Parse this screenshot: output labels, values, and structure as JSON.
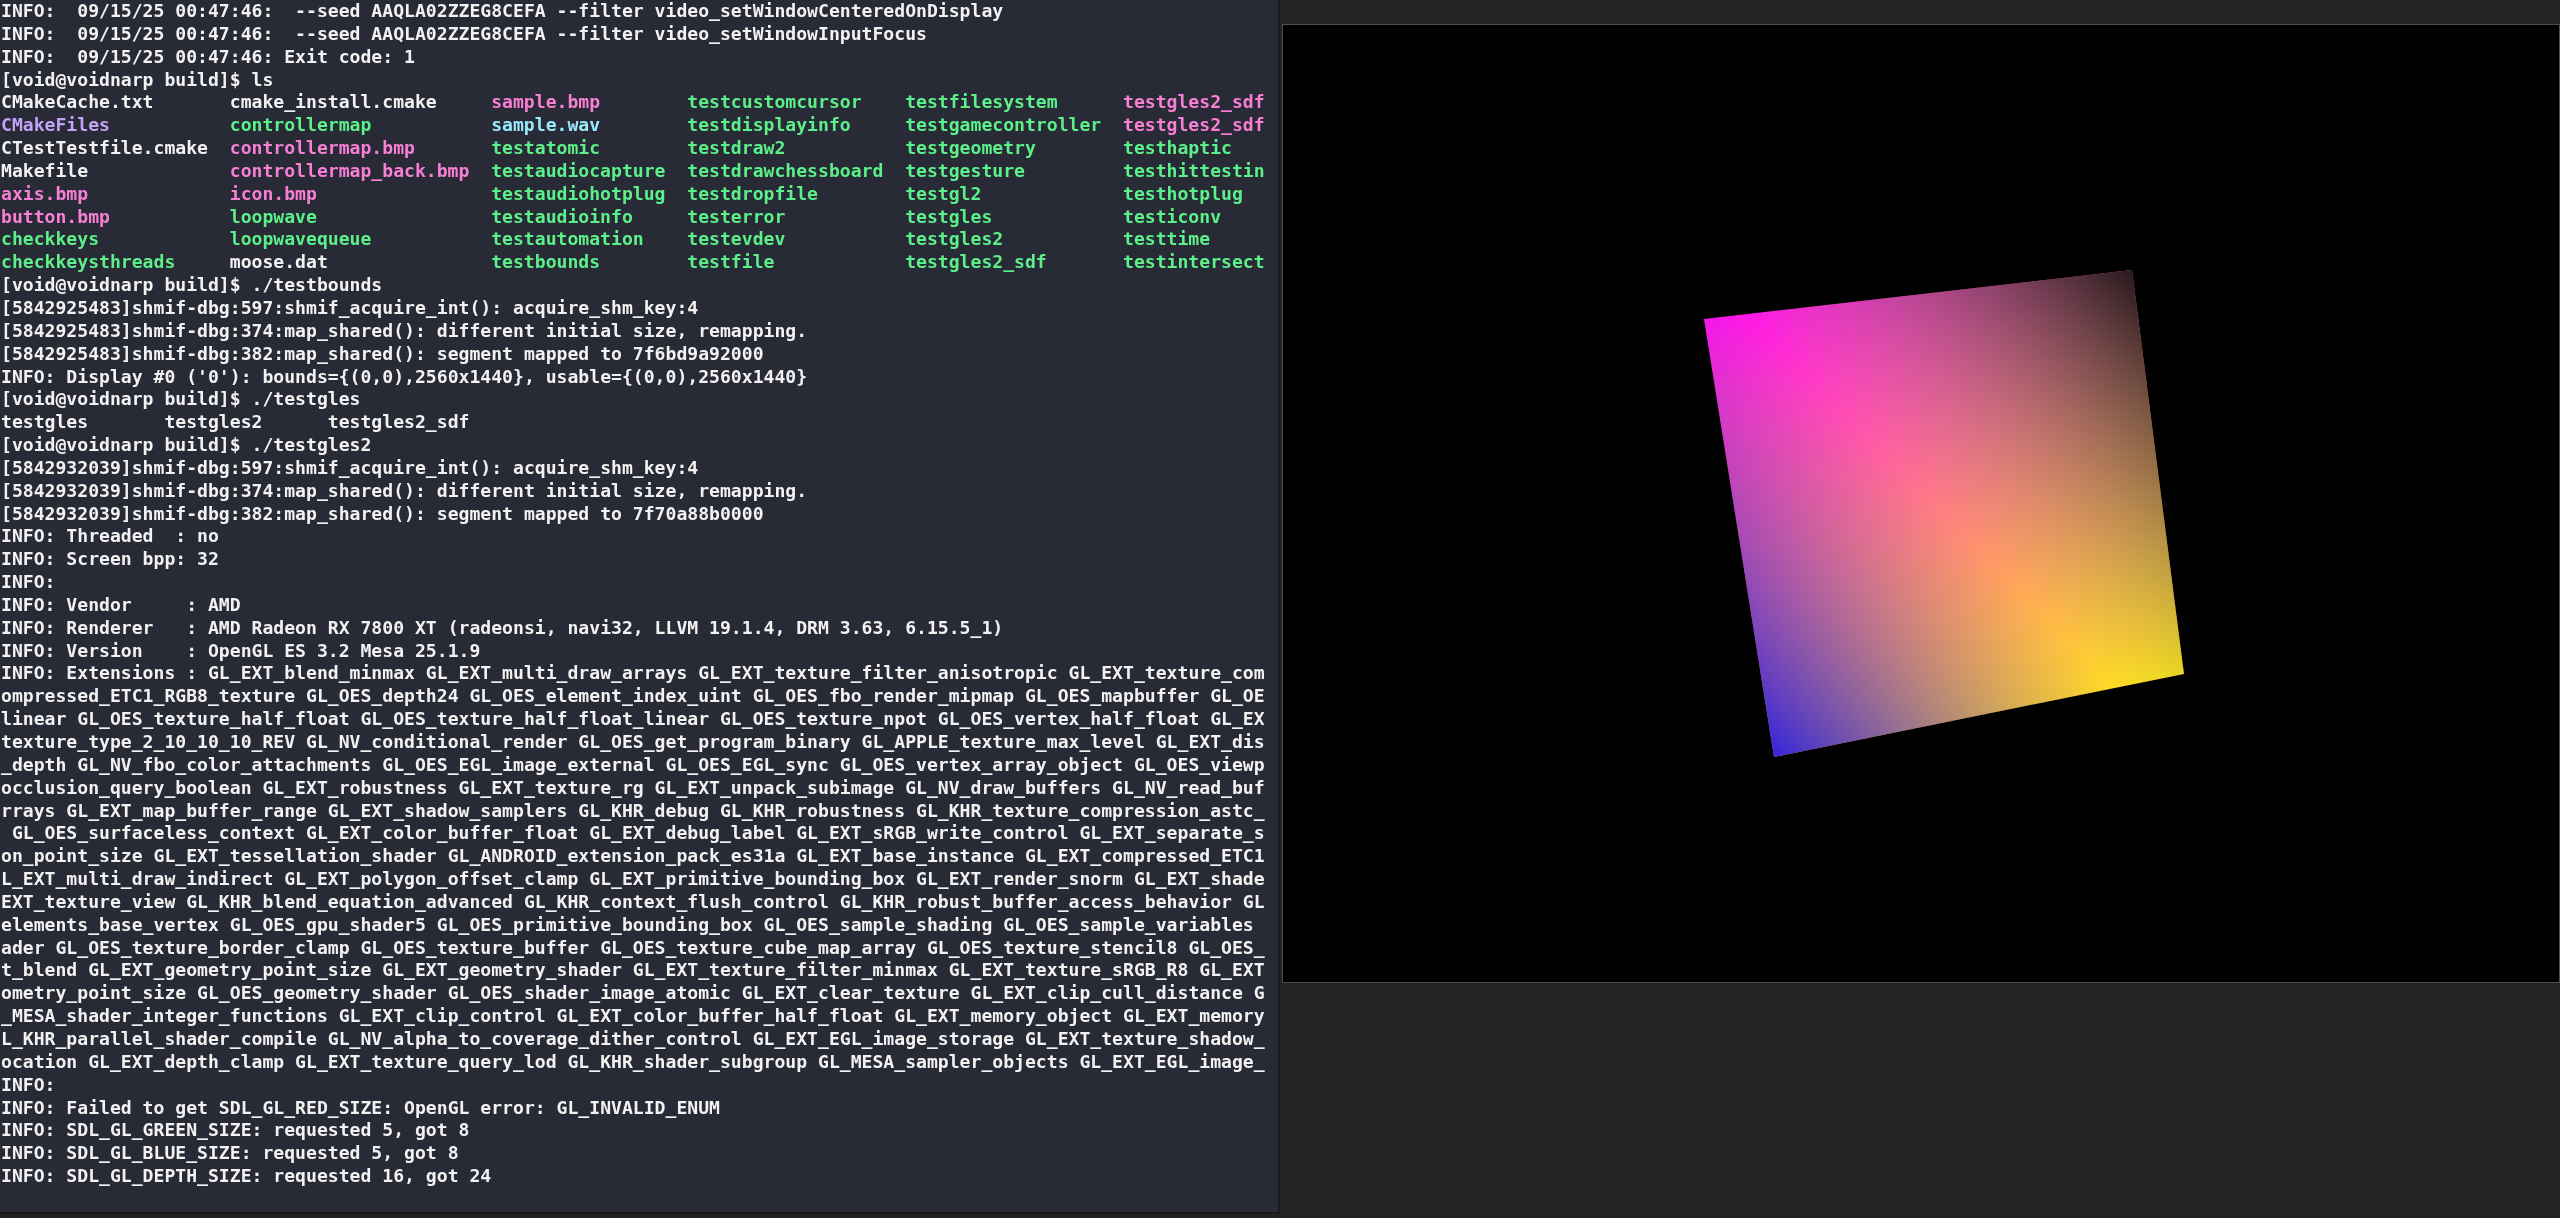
{
  "terminal": {
    "lines": [
      {
        "kind": "text",
        "text": "INFO:  09/15/25 00:47:46:  --seed AAQLA02ZZEG8CEFA --filter video_setWindowCenteredOnDisplay"
      },
      {
        "kind": "text",
        "text": "INFO:  09/15/25 00:47:46:  --seed AAQLA02ZZEG8CEFA --filter video_setWindowInputFocus"
      },
      {
        "kind": "text",
        "text": "INFO:  09/15/25 00:47:46: Exit code: 1"
      },
      {
        "kind": "text",
        "text": "[void@voidnarp build]$ ls"
      },
      {
        "kind": "listing",
        "rows": [
          [
            {
              "text": "CMakeCache.txt",
              "color": "#f2f2f2"
            },
            {
              "text": "cmake_install.cmake",
              "color": "#f2f2f2"
            },
            {
              "text": "sample.bmp",
              "color": "#f77fd6"
            },
            {
              "text": "testcustomcursor",
              "color": "#5cf08a"
            },
            {
              "text": "testfilesystem",
              "color": "#5cf08a"
            },
            {
              "text": "testgles2_sdf",
              "color": "#f77fd6"
            }
          ],
          [
            {
              "text": "CMakeFiles",
              "color": "#c3a3f7"
            },
            {
              "text": "controllermap",
              "color": "#5cf08a"
            },
            {
              "text": "sample.wav",
              "color": "#9ae8fc"
            },
            {
              "text": "testdisplayinfo",
              "color": "#5cf08a"
            },
            {
              "text": "testgamecontroller",
              "color": "#5cf08a"
            },
            {
              "text": "testgles2_sdf",
              "color": "#f77fd6"
            }
          ],
          [
            {
              "text": "CTestTestfile.cmake",
              "color": "#f2f2f2"
            },
            {
              "text": "controllermap.bmp",
              "color": "#f77fd6"
            },
            {
              "text": "testatomic",
              "color": "#5cf08a"
            },
            {
              "text": "testdraw2",
              "color": "#5cf08a"
            },
            {
              "text": "testgeometry",
              "color": "#5cf08a"
            },
            {
              "text": "testhaptic",
              "color": "#5cf08a"
            }
          ],
          [
            {
              "text": "Makefile",
              "color": "#f2f2f2"
            },
            {
              "text": "controllermap_back.bmp",
              "color": "#f77fd6"
            },
            {
              "text": "testaudiocapture",
              "color": "#5cf08a"
            },
            {
              "text": "testdrawchessboard",
              "color": "#5cf08a"
            },
            {
              "text": "testgesture",
              "color": "#5cf08a"
            },
            {
              "text": "testhittestin",
              "color": "#5cf08a"
            }
          ],
          [
            {
              "text": "axis.bmp",
              "color": "#f77fd6"
            },
            {
              "text": "icon.bmp",
              "color": "#f77fd6"
            },
            {
              "text": "testaudiohotplug",
              "color": "#5cf08a"
            },
            {
              "text": "testdropfile",
              "color": "#5cf08a"
            },
            {
              "text": "testgl2",
              "color": "#5cf08a"
            },
            {
              "text": "testhotplug",
              "color": "#5cf08a"
            }
          ],
          [
            {
              "text": "button.bmp",
              "color": "#f77fd6"
            },
            {
              "text": "loopwave",
              "color": "#5cf08a"
            },
            {
              "text": "testaudioinfo",
              "color": "#5cf08a"
            },
            {
              "text": "testerror",
              "color": "#5cf08a"
            },
            {
              "text": "testgles",
              "color": "#5cf08a"
            },
            {
              "text": "testiconv",
              "color": "#5cf08a"
            }
          ],
          [
            {
              "text": "checkkeys",
              "color": "#5cf08a"
            },
            {
              "text": "loopwavequeue",
              "color": "#5cf08a"
            },
            {
              "text": "testautomation",
              "color": "#5cf08a"
            },
            {
              "text": "testevdev",
              "color": "#5cf08a"
            },
            {
              "text": "testgles2",
              "color": "#5cf08a"
            },
            {
              "text": "testtime",
              "color": "#5cf08a"
            }
          ],
          [
            {
              "text": "checkkeysthreads",
              "color": "#5cf08a"
            },
            {
              "text": "moose.dat",
              "color": "#f2f2f2"
            },
            {
              "text": "testbounds",
              "color": "#5cf08a"
            },
            {
              "text": "testfile",
              "color": "#5cf08a"
            },
            {
              "text": "testgles2_sdf",
              "color": "#5cf08a"
            },
            {
              "text": "testintersect",
              "color": "#5cf08a"
            }
          ]
        ]
      },
      {
        "kind": "text",
        "text": "[void@voidnarp build]$ ./testbounds"
      },
      {
        "kind": "text",
        "text": "[5842925483]shmif-dbg:597:shmif_acquire_int(): acquire_shm_key:4"
      },
      {
        "kind": "text",
        "text": "[5842925483]shmif-dbg:374:map_shared(): different initial size, remapping."
      },
      {
        "kind": "text",
        "text": "[5842925483]shmif-dbg:382:map_shared(): segment mapped to 7f6bd9a92000"
      },
      {
        "kind": "text",
        "text": "INFO: Display #0 ('0'): bounds={(0,0),2560x1440}, usable={(0,0),2560x1440}"
      },
      {
        "kind": "text",
        "text": "[void@voidnarp build]$ ./testgles"
      },
      {
        "kind": "text",
        "text": "testgles       testgles2      testgles2_sdf"
      },
      {
        "kind": "text",
        "text": "[void@voidnarp build]$ ./testgles2"
      },
      {
        "kind": "text",
        "text": "[5842932039]shmif-dbg:597:shmif_acquire_int(): acquire_shm_key:4"
      },
      {
        "kind": "text",
        "text": "[5842932039]shmif-dbg:374:map_shared(): different initial size, remapping."
      },
      {
        "kind": "text",
        "text": "[5842932039]shmif-dbg:382:map_shared(): segment mapped to 7f70a88b0000"
      },
      {
        "kind": "text",
        "text": "INFO: Threaded  : no"
      },
      {
        "kind": "text",
        "text": "INFO: Screen bpp: 32"
      },
      {
        "kind": "text",
        "text": "INFO:"
      },
      {
        "kind": "text",
        "text": "INFO: Vendor     : AMD"
      },
      {
        "kind": "text",
        "text": "INFO: Renderer   : AMD Radeon RX 7800 XT (radeonsi, navi32, LLVM 19.1.4, DRM 3.63, 6.15.5_1)"
      },
      {
        "kind": "text",
        "text": "INFO: Version    : OpenGL ES 3.2 Mesa 25.1.9"
      },
      {
        "kind": "text",
        "text": "INFO: Extensions : GL_EXT_blend_minmax GL_EXT_multi_draw_arrays GL_EXT_texture_filter_anisotropic GL_EXT_texture_com"
      },
      {
        "kind": "text",
        "text": "ompressed_ETC1_RGB8_texture GL_OES_depth24 GL_OES_element_index_uint GL_OES_fbo_render_mipmap GL_OES_mapbuffer GL_OE"
      },
      {
        "kind": "text",
        "text": "linear GL_OES_texture_half_float GL_OES_texture_half_float_linear GL_OES_texture_npot GL_OES_vertex_half_float GL_EX"
      },
      {
        "kind": "text",
        "text": "texture_type_2_10_10_10_REV GL_NV_conditional_render GL_OES_get_program_binary GL_APPLE_texture_max_level GL_EXT_dis"
      },
      {
        "kind": "text",
        "text": "_depth GL_NV_fbo_color_attachments GL_OES_EGL_image_external GL_OES_EGL_sync GL_OES_vertex_array_object GL_OES_viewp"
      },
      {
        "kind": "text",
        "text": "occlusion_query_boolean GL_EXT_robustness GL_EXT_texture_rg GL_EXT_unpack_subimage GL_NV_draw_buffers GL_NV_read_buf"
      },
      {
        "kind": "text",
        "text": "rrays GL_EXT_map_buffer_range GL_EXT_shadow_samplers GL_KHR_debug GL_KHR_robustness GL_KHR_texture_compression_astc_"
      },
      {
        "kind": "text",
        "text": " GL_OES_surfaceless_context GL_EXT_color_buffer_float GL_EXT_debug_label GL_EXT_sRGB_write_control GL_EXT_separate_s"
      },
      {
        "kind": "text",
        "text": "on_point_size GL_EXT_tessellation_shader GL_ANDROID_extension_pack_es31a GL_EXT_base_instance GL_EXT_compressed_ETC1"
      },
      {
        "kind": "text",
        "text": "L_EXT_multi_draw_indirect GL_EXT_polygon_offset_clamp GL_EXT_primitive_bounding_box GL_EXT_render_snorm GL_EXT_shade"
      },
      {
        "kind": "text",
        "text": "EXT_texture_view GL_KHR_blend_equation_advanced GL_KHR_context_flush_control GL_KHR_robust_buffer_access_behavior GL"
      },
      {
        "kind": "text",
        "text": "elements_base_vertex GL_OES_gpu_shader5 GL_OES_primitive_bounding_box GL_OES_sample_shading GL_OES_sample_variables"
      },
      {
        "kind": "text",
        "text": "ader GL_OES_texture_border_clamp GL_OES_texture_buffer GL_OES_texture_cube_map_array GL_OES_texture_stencil8 GL_OES_"
      },
      {
        "kind": "text",
        "text": "t_blend GL_EXT_geometry_point_size GL_EXT_geometry_shader GL_EXT_texture_filter_minmax GL_EXT_texture_sRGB_R8 GL_EXT"
      },
      {
        "kind": "text",
        "text": "ometry_point_size GL_OES_geometry_shader GL_OES_shader_image_atomic GL_EXT_clear_texture GL_EXT_clip_cull_distance G"
      },
      {
        "kind": "text",
        "text": "_MESA_shader_integer_functions GL_EXT_clip_control GL_EXT_color_buffer_half_float GL_EXT_memory_object GL_EXT_memory"
      },
      {
        "kind": "text",
        "text": "L_KHR_parallel_shader_compile GL_NV_alpha_to_coverage_dither_control GL_EXT_EGL_image_storage GL_EXT_texture_shadow_"
      },
      {
        "kind": "text",
        "text": "ocation GL_EXT_depth_clamp GL_EXT_texture_query_lod GL_KHR_shader_subgroup GL_MESA_sampler_objects GL_EXT_EGL_image_"
      },
      {
        "kind": "text",
        "text": "INFO:"
      },
      {
        "kind": "text",
        "text": "INFO: Failed to get SDL_GL_RED_SIZE: OpenGL error: GL_INVALID_ENUM"
      },
      {
        "kind": "text",
        "text": "INFO: SDL_GL_GREEN_SIZE: requested 5, got 8"
      },
      {
        "kind": "text",
        "text": "INFO: SDL_GL_BLUE_SIZE: requested 5, got 8"
      },
      {
        "kind": "text",
        "text": "INFO: SDL_GL_DEPTH_SIZE: requested 16, got 24"
      }
    ]
  }
}
